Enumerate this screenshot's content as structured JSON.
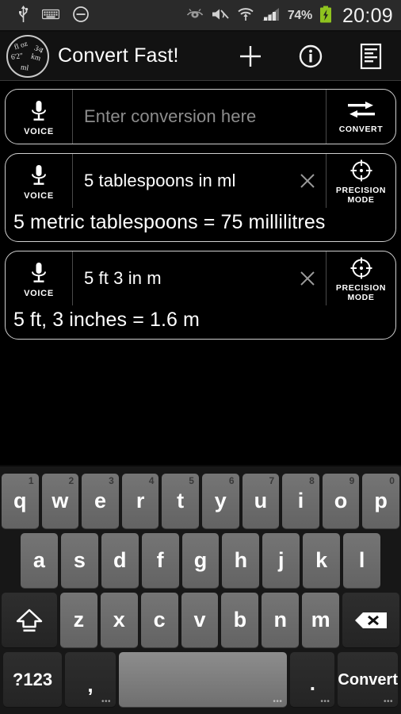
{
  "statusbar": {
    "icons": [
      "usb-icon",
      "keyboard-icon",
      "do-not-disturb-icon",
      "eye-icon",
      "mute-icon",
      "wifi-icon",
      "signal-icon"
    ],
    "battery_percent": "74%",
    "battery_state": "charging",
    "time": "20:09",
    "battery_color": "#8fc31f"
  },
  "appbar": {
    "logo": {
      "t1": "fl oz",
      "t2": "3⁄4",
      "t3": "6'2\"",
      "t4": "km",
      "t5": "ml"
    },
    "title": "Convert Fast!",
    "actions": [
      {
        "name": "add-icon",
        "label": "Add"
      },
      {
        "name": "info-icon",
        "label": "Info"
      },
      {
        "name": "history-icon",
        "label": "History"
      }
    ]
  },
  "cards": [
    {
      "voice_label": "VOICE",
      "input_value": "",
      "input_placeholder": "Enter conversion here",
      "has_clear": false,
      "action_label": "CONVERT",
      "action_icon": "convert-arrows-icon",
      "result": ""
    },
    {
      "voice_label": "VOICE",
      "input_value": "5 tablespoons in ml",
      "input_placeholder": "Enter conversion here",
      "has_clear": true,
      "action_label": "PRECISION\nMODE",
      "action_label_line1": "PRECISION",
      "action_label_line2": "MODE",
      "action_icon": "precision-crosshair-icon",
      "result": "5 metric tablespoons = 75 millilitres"
    },
    {
      "voice_label": "VOICE",
      "input_value": "5 ft 3 in m",
      "input_placeholder": "Enter conversion here",
      "has_clear": true,
      "action_label_line1": "PRECISION",
      "action_label_line2": "MODE",
      "action_icon": "precision-crosshair-icon",
      "result": "5 ft, 3 inches = 1.6 m"
    }
  ],
  "keyboard": {
    "row1": [
      {
        "key": "q",
        "num": "1"
      },
      {
        "key": "w",
        "num": "2"
      },
      {
        "key": "e",
        "num": "3"
      },
      {
        "key": "r",
        "num": "4"
      },
      {
        "key": "t",
        "num": "5"
      },
      {
        "key": "y",
        "num": "6"
      },
      {
        "key": "u",
        "num": "7"
      },
      {
        "key": "i",
        "num": "8"
      },
      {
        "key": "o",
        "num": "9"
      },
      {
        "key": "p",
        "num": "0"
      }
    ],
    "row2": [
      {
        "key": "a"
      },
      {
        "key": "s"
      },
      {
        "key": "d"
      },
      {
        "key": "f"
      },
      {
        "key": "g"
      },
      {
        "key": "h"
      },
      {
        "key": "j"
      },
      {
        "key": "k"
      },
      {
        "key": "l"
      }
    ],
    "row3": [
      {
        "key": "z"
      },
      {
        "key": "x"
      },
      {
        "key": "c"
      },
      {
        "key": "v"
      },
      {
        "key": "b"
      },
      {
        "key": "n"
      },
      {
        "key": "m"
      }
    ],
    "shift_icon": "shift-icon",
    "backspace_icon": "backspace-icon",
    "symbols_label": "?123",
    "comma_label": ",",
    "space_label": "",
    "period_label": ".",
    "convert_label": "Convert",
    "hint_dots": "•••"
  }
}
